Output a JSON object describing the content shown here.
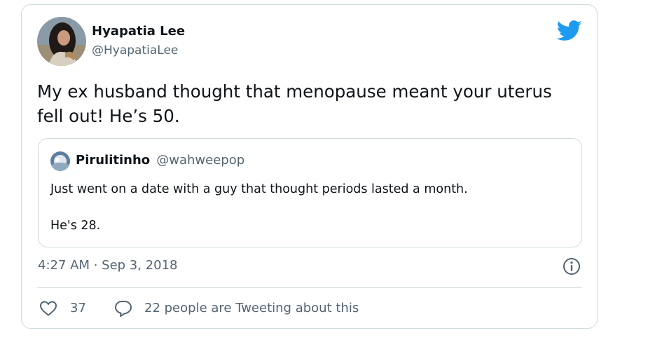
{
  "tweet": {
    "author": {
      "name": "Hyapatia Lee",
      "handle": "@HyapatiaLee"
    },
    "text": "My ex husband thought that menopause meant your uterus\nfell out! He’s 50.",
    "quoted": {
      "author_name": "Pirulitinho",
      "author_handle": "@wahweepop",
      "text": "Just went on a date with a guy that thought periods lasted a month.\n\nHe's 28."
    },
    "timestamp": "4:27 AM · Sep 3, 2018",
    "likes": "37",
    "reply_text": "22 people are Tweeting about this"
  },
  "colors": {
    "twitter_blue": "#1d9bf0",
    "secondary_text": "#536471",
    "border": "#cfd9de"
  },
  "icons": {
    "brand": "twitter-bird-icon",
    "info": "info-icon",
    "like": "heart-icon",
    "reply": "speech-bubble-icon"
  }
}
